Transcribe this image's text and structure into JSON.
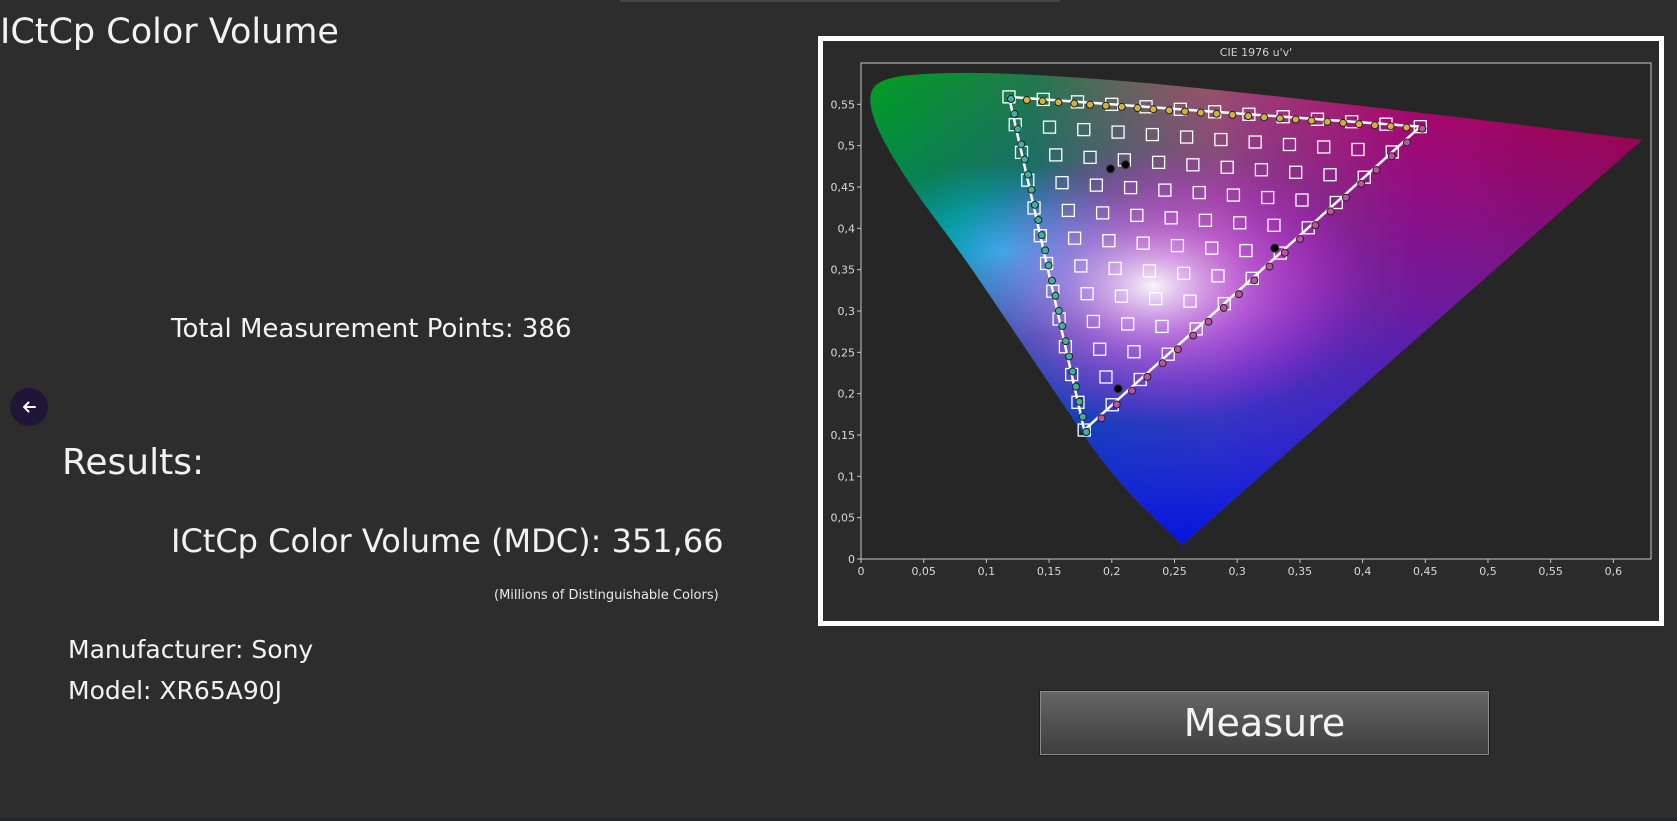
{
  "page": {
    "title": "ICtCp Color Volume",
    "back_icon": "arrow-left-icon"
  },
  "stats": {
    "total_points": "Total Measurement Points: 386"
  },
  "results": {
    "heading": "Results:",
    "volume": "ICtCp Color Volume (MDC): 351,66",
    "volume_note": "(Millions of Distinguishable  Colors)",
    "manufacturer": "Manufacturer: Sony",
    "model": "Model: XR65A90J"
  },
  "actions": {
    "measure_label": "Measure"
  },
  "colors": {
    "background": "#2d2d2d",
    "button_top": "#656565",
    "button_bottom": "#3e3e3e",
    "back_button": "#1f1538"
  },
  "chart_data": {
    "type": "scatter",
    "title": "CIE 1976 u'v'",
    "xlim": [
      0,
      0.63
    ],
    "ylim": [
      0,
      0.6
    ],
    "x_ticks": [
      "0",
      "0,05",
      "0,1",
      "0,15",
      "0,2",
      "0,25",
      "0,3",
      "0,35",
      "0,4",
      "0,45",
      "0,5",
      "0,55",
      "0,6"
    ],
    "y_ticks": [
      "0",
      "0,05",
      "0,1",
      "0,15",
      "0,2",
      "0,25",
      "0,3",
      "0,35",
      "0,4",
      "0,45",
      "0,5",
      "0,55"
    ],
    "gamut_triangle": [
      [
        0.118,
        0.559
      ],
      [
        0.446,
        0.523
      ],
      [
        0.178,
        0.156
      ]
    ],
    "spectral_locus": [
      [
        0.256,
        0.017
      ],
      [
        0.2,
        0.1
      ],
      [
        0.16,
        0.19
      ],
      [
        0.12,
        0.28
      ],
      [
        0.08,
        0.37
      ],
      [
        0.04,
        0.45
      ],
      [
        0.012,
        0.52
      ],
      [
        0.005,
        0.565
      ],
      [
        0.02,
        0.583
      ],
      [
        0.06,
        0.588
      ],
      [
        0.11,
        0.588
      ],
      [
        0.2,
        0.58
      ],
      [
        0.3,
        0.565
      ],
      [
        0.4,
        0.548
      ],
      [
        0.5,
        0.53
      ],
      [
        0.58,
        0.515
      ],
      [
        0.623,
        0.507
      ]
    ],
    "measured_highlights": [
      [
        0.211,
        0.477
      ],
      [
        0.199,
        0.472
      ],
      [
        0.33,
        0.376
      ],
      [
        0.205,
        0.206
      ]
    ]
  }
}
